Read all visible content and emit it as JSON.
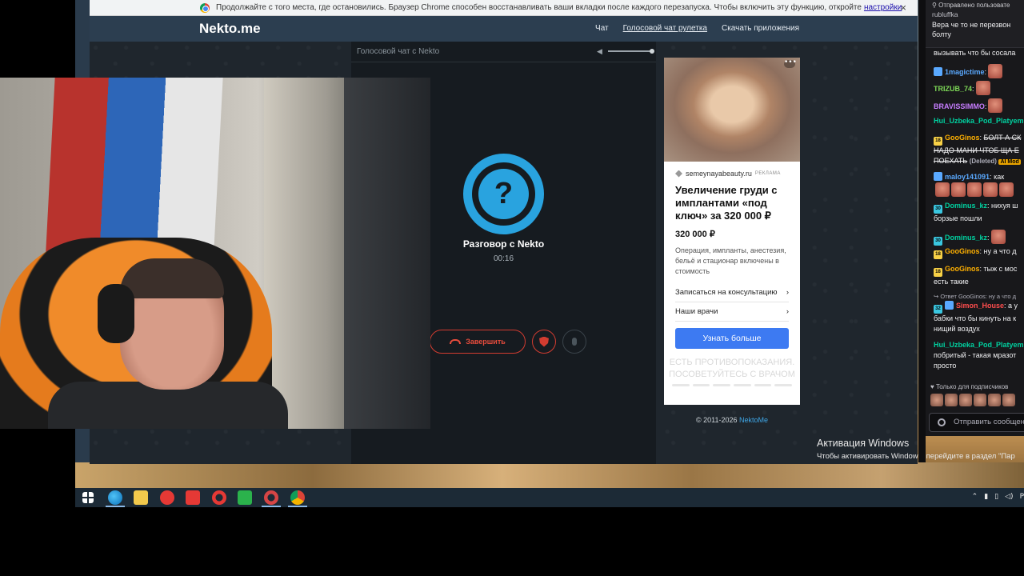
{
  "browser": {
    "infobar": {
      "text": "Продолжайте с того места, где остановились. Браузер Chrome способен восстанавливать ваши вкладки после каждого перезапуска. Чтобы включить эту функцию, откройте",
      "link": "настройки",
      "close": "×"
    }
  },
  "site": {
    "logo": "Nekto.me",
    "nav": [
      "Чат",
      "Голосовой чат рулетка",
      "Скачать приложения"
    ],
    "panel_title": "Голосовой чат с Nekto",
    "avatar_symbol": "?",
    "call_title": "Разговор с Nekto",
    "timer": "00:16",
    "end_button": "Завершить",
    "copyright_prefix": "© 2011-2026",
    "copyright_link": "NektoMe"
  },
  "ad": {
    "more": "•••",
    "source": "semeynayabeauty.ru",
    "tag": "РЕКЛАМА",
    "title": "Увеличение груди с имплантами «под ключ» за 320 000 ₽",
    "price": "320 000 ₽",
    "description": "Операция, импланты, анестезия, бельё и стационар включены в стоимость",
    "links": [
      "Записаться на консультацию",
      "Наши врачи"
    ],
    "cta": "Узнать больше",
    "disclaimer": "ЕСТЬ ПРОТИВОПОКАЗАНИЯ. ПОСОВЕТУЙТЕСЬ С ВРАЧОМ"
  },
  "windows": {
    "activation_title": "Активация Windows",
    "activation_sub": "Чтобы активировать Windows, перейдите в раздел \"Пар"
  },
  "chat": {
    "pinned_header": "Отправлено пользовате",
    "pinned_user": "rubluffka",
    "pinned_text": "Вера че то не перезвон болту",
    "messages": [
      {
        "text": "вызывать что бы сосала"
      },
      {
        "user": "1magictime",
        "user_color": "#5aa9ff"
      },
      {
        "user": "TRIZUB_74",
        "user_color": "#7ed957"
      },
      {
        "user": "BRAVISSIMMO",
        "user_color": "#c77dff"
      },
      {
        "user": "Hui_Uzbeka_Pod_Platyem",
        "user_color": "#00d1a0"
      },
      {
        "user": "GooGinos",
        "user_color": "#ffb000",
        "text": "БОЛТ А СК",
        "line2": "НАДО МАНИ ЧТОБ ЩА Е",
        "line3": "ПОЕХАТЬ",
        "deleted": "(Deleted)",
        "ai": "AI Mod"
      },
      {
        "user": "maloy141091",
        "user_color": "#5aa9ff",
        "text": "как"
      },
      {
        "user": "Dominus_kz",
        "user_color": "#00d1a0",
        "text": "нихуя ш",
        "line2": "борзые пошли"
      },
      {
        "user": "Dominus_kz",
        "user_color": "#00d1a0"
      },
      {
        "user": "GooGinos",
        "user_color": "#ffb000",
        "text": "ну а что д"
      },
      {
        "user": "GooGinos",
        "user_color": "#ffb000",
        "text": "тыж с мос",
        "line2": "есть такие"
      },
      {
        "reply": "Ответ GooGinos: ну а что д",
        "user": "Simon_House",
        "user_color": "#ff4d4d",
        "text": "а у",
        "line2": "бабки что бы кинуть на к",
        "line3": "нищий воздух"
      },
      {
        "user": "Hui_Uzbeka_Pod_Platyem",
        "user_color": "#00d1a0",
        "line2": "побритый - такая мразот",
        "line3": "просто"
      }
    ],
    "subs_only": "Только для подписчиков",
    "input_placeholder": "Отправить сообщение"
  },
  "taskbar": {
    "tray_lang": "Р"
  }
}
